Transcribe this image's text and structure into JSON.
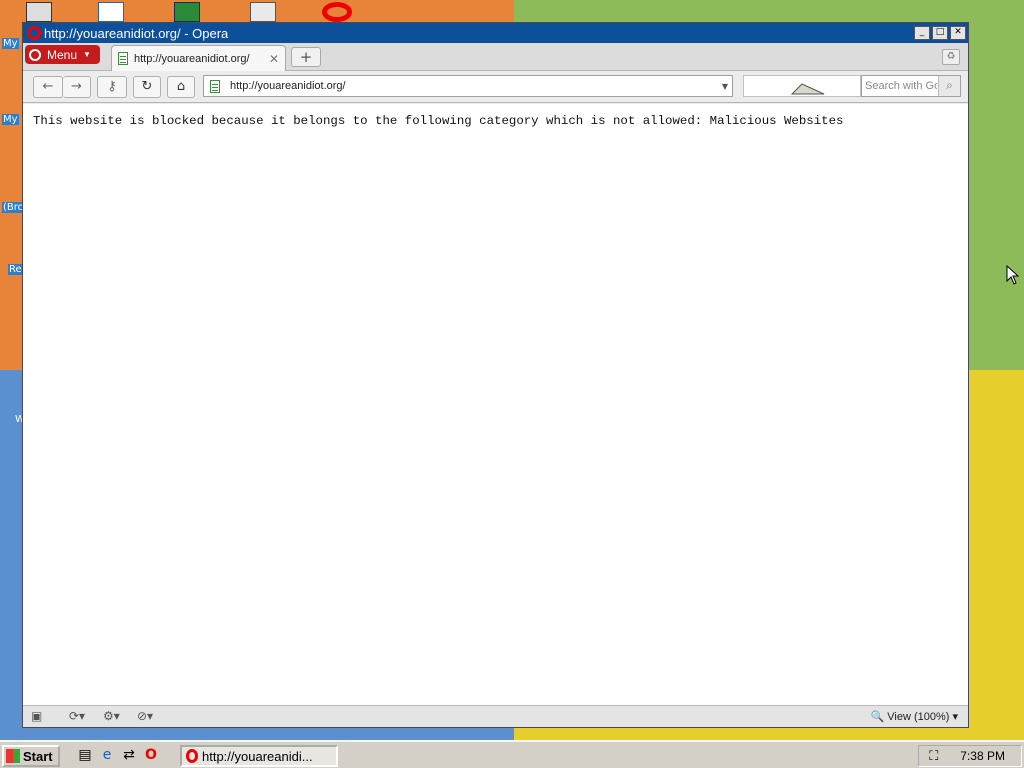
{
  "window": {
    "title": "http://youareanidiot.org/ - Opera",
    "minimize": "_",
    "maximize": "□",
    "close": "✕"
  },
  "menu": {
    "label": "Menu"
  },
  "tab": {
    "title": "http://youareanidiot.org/",
    "close": "✕"
  },
  "new_tab": "+",
  "toolbar": {
    "address": "http://youareanidiot.org/",
    "search_placeholder": "Search with Google"
  },
  "content": {
    "message": "This website is blocked because it belongs to the following category which is not allowed: Malicious Websites"
  },
  "statusbar": {
    "zoom": "View (100%)"
  },
  "taskbar": {
    "start": "Start",
    "task_title": "http://youareanidi...",
    "clock": "7:38 PM"
  },
  "desktop": {
    "labels": [
      "My",
      "My",
      "(Bro",
      "Re",
      "W"
    ]
  },
  "colors": {
    "titlebar": "#0c4f9a",
    "menu_red": "#c41c1c",
    "opera_red": "#ee0000"
  }
}
